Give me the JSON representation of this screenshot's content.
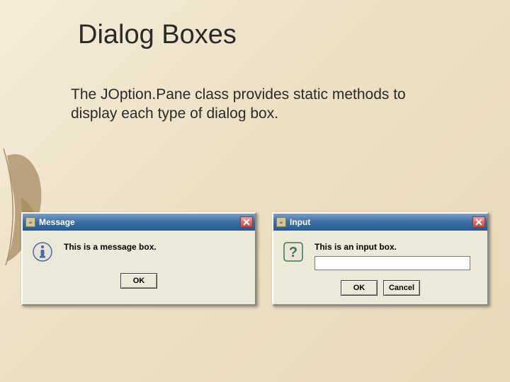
{
  "slide": {
    "title": "Dialog Boxes",
    "body": "The JOption.Pane class provides static methods to display each type of dialog box."
  },
  "dialog1": {
    "title": "Message",
    "message": "This is a message box.",
    "ok": "OK"
  },
  "dialog2": {
    "title": "Input",
    "message": "This is an input box.",
    "input_value": "",
    "ok": "OK",
    "cancel": "Cancel"
  }
}
